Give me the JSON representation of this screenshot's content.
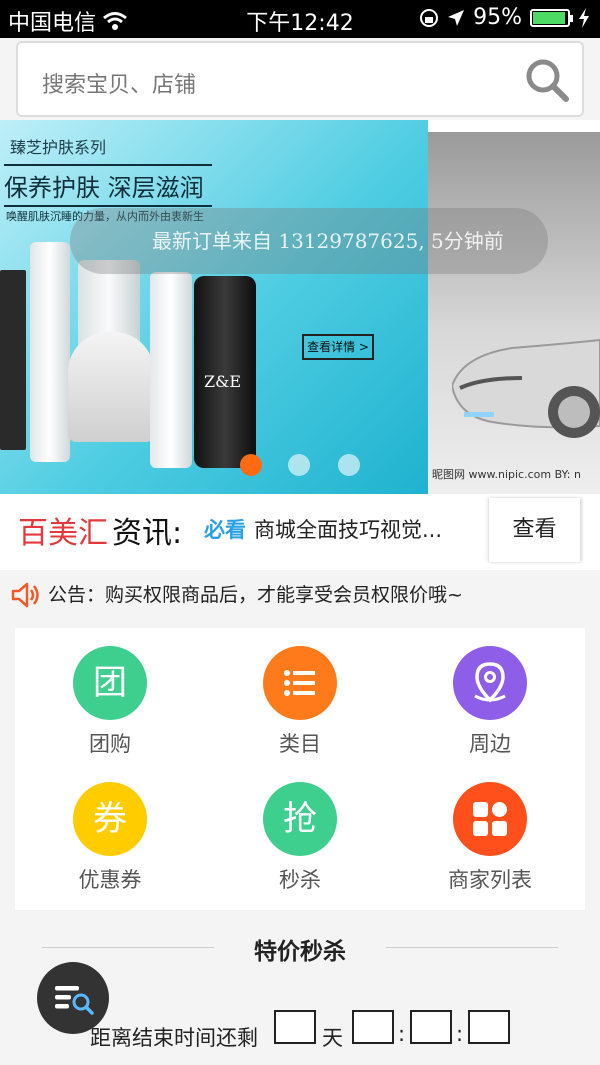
{
  "status_bar": {
    "carrier": "中国电信",
    "time": "下午12:42",
    "battery": "95%",
    "battery_level": 0.95
  },
  "search": {
    "placeholder": "搜索宝贝、店铺"
  },
  "banner": {
    "slide1": {
      "series": "臻芝护肤系列",
      "headline": "保养护肤 深层滋润",
      "subline": "唤醒肌肤沉睡的力量，从内而外由衷新生",
      "brand": "Z&E",
      "detail_button": "查看详情 >"
    },
    "order_notice": "最新订单来自  13129787625, 5分钟前",
    "watermark": "昵图网 www.nipic.com   BY: n",
    "active_dot": 0,
    "dot_count": 3
  },
  "news": {
    "brand_red": "百美汇",
    "brand_black": "资讯:",
    "tag": "必看",
    "text": "商城全面技巧视觉...",
    "view_button": "查看"
  },
  "notice": {
    "text": "公告：购买权限商品后，才能享受会员权限价哦~"
  },
  "categories": [
    {
      "label": "团购",
      "glyph": "团",
      "color": "#3ecf8e",
      "icon": "group-buy-icon"
    },
    {
      "label": "类目",
      "glyph": "",
      "color": "#ff7a1a",
      "icon": "category-list-icon"
    },
    {
      "label": "周边",
      "glyph": "",
      "color": "#8e5ee8",
      "icon": "location-pin-icon"
    },
    {
      "label": "优惠券",
      "glyph": "券",
      "color": "#ffcc00",
      "icon": "coupon-icon"
    },
    {
      "label": "秒杀",
      "glyph": "抢",
      "color": "#3ecf8e",
      "icon": "flash-sale-icon"
    },
    {
      "label": "商家列表",
      "glyph": "",
      "color": "#ff4f1a",
      "icon": "merchant-grid-icon"
    }
  ],
  "flash_sale": {
    "title": "特价秒杀",
    "countdown_label": "距离结束时间还剩",
    "day_unit": "天",
    "separator": ":"
  }
}
